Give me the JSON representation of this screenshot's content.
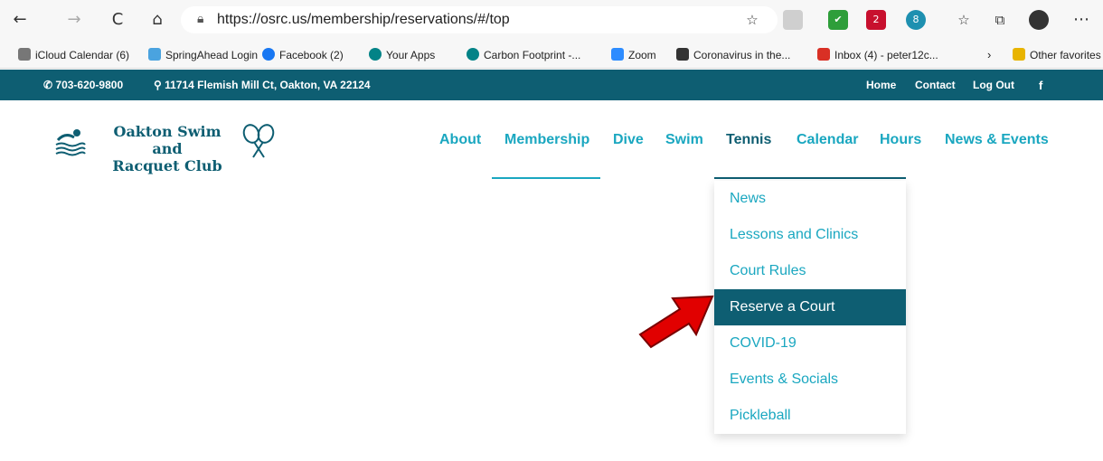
{
  "browser": {
    "url": "https://osrc.us/membership/reservations/#/top",
    "back_icon": "←",
    "forward_icon": "→",
    "reload_icon": "C",
    "home_icon": "⌂",
    "ext_badge_1": "2",
    "ext_badge_2": "8"
  },
  "bookmarks": [
    {
      "label": "iCloud Calendar (6)",
      "color": "#777777"
    },
    {
      "label": "SpringAhead Login",
      "color": "#4aa3df"
    },
    {
      "label": "Facebook (2)",
      "color": "#1877f2"
    },
    {
      "label": "Your Apps",
      "color": "#038387"
    },
    {
      "label": "Carbon Footprint -...",
      "color": "#038387"
    },
    {
      "label": "Zoom",
      "color": "#2d8cff"
    },
    {
      "label": "Coronavirus in the...",
      "color": "#333333"
    },
    {
      "label": "Inbox (4) - peter12c...",
      "color": "#d93025"
    },
    {
      "label": "Other favorites",
      "color": "#e8b400"
    }
  ],
  "topbar": {
    "phone": "703-620-9800",
    "address": "11714 Flemish Mill Ct, Oakton, VA 22124",
    "home": "Home",
    "contact": "Contact",
    "logout": "Log Out",
    "facebook": "f"
  },
  "logo": {
    "line1": "Oakton Swim and",
    "line2": "Racquet Club"
  },
  "menu": {
    "about": "About",
    "membership": "Membership",
    "dive": "Dive",
    "swim": "Swim",
    "tennis": "Tennis",
    "calendar": "Calendar",
    "hours": "Hours",
    "news_events": "News & Events"
  },
  "tennis_dropdown": {
    "items": [
      "News",
      "Lessons and Clinics",
      "Court Rules",
      "Reserve a Court",
      "COVID-19",
      "Events & Socials",
      "Pickleball"
    ],
    "selected": "Reserve a Court"
  },
  "colors": {
    "brand_dark": "#0e5e72",
    "brand_light": "#1aa7c0",
    "arrow": "#e10000"
  }
}
